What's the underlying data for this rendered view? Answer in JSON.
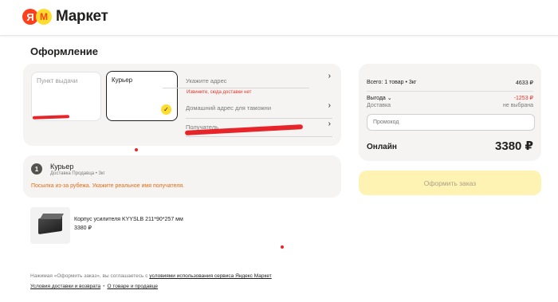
{
  "header": {
    "logo_ya": "Я",
    "logo_m": "M",
    "logo_text": "Маркет"
  },
  "page": {
    "title": "Оформление"
  },
  "delivery": {
    "options": [
      {
        "label": "Пункт выдачи",
        "selected": false
      },
      {
        "label": "Курьер",
        "selected": true
      }
    ],
    "address_label": "Укажите адрес",
    "address_error": "Извините, сюда доставки нет",
    "customs_label": "Домашний адрес для таможни",
    "recipient_label": "Получатель"
  },
  "courier": {
    "step": "1",
    "title": "Курьер",
    "subtitle": "Доставка Продавца • 3кг",
    "warning": "Посылка из-за рубежа. Укажите реальное имя получателя."
  },
  "product": {
    "name": "Корпус усилителя KYYSLB 211*90*257 мм",
    "price": "3380 ₽"
  },
  "legal": {
    "text_before": "Нажимая «Оформить заказ», вы соглашаетесь с ",
    "text_link": "условиями использования сервиса Яндекс Маркет",
    "link_delivery": "Условия доставки и возврата",
    "link_sep": "•",
    "link_about": "О товаре и продавце"
  },
  "summary": {
    "items_label": "Всего: 1 товар • 3кг",
    "items_value": "4633 ₽",
    "benefit_label": "Выгода",
    "benefit_value": "-1253 ₽",
    "shipping_label": "Доставка",
    "shipping_value": "не выбрана",
    "promo_placeholder": "Промокод",
    "total_label": "Онлайн",
    "total_value": "3380 ₽"
  },
  "order_button": "Оформить заказ",
  "colors": {
    "brand_red": "#fc3f1d",
    "brand_yellow": "#ffdd2d",
    "error": "#e5332a",
    "warning": "#e86a12"
  }
}
